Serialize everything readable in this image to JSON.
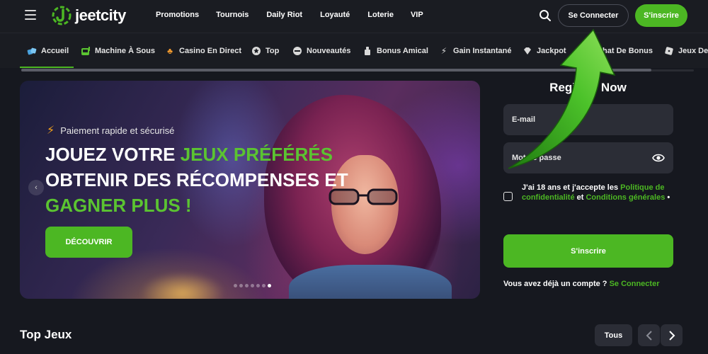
{
  "header": {
    "logo_text": "jeetcity",
    "nav": [
      "Promotions",
      "Tournois",
      "Daily Riot",
      "Loyauté",
      "Loterie",
      "VIP"
    ],
    "login_label": "Se Connecter",
    "signup_label": "S'inscrire"
  },
  "categories": [
    {
      "label": "Accueil",
      "icon": "home-icon",
      "active": true
    },
    {
      "label": "Machine À Sous",
      "icon": "slot-machine-icon"
    },
    {
      "label": "Casino En Direct",
      "icon": "club-icon"
    },
    {
      "label": "Top",
      "icon": "star-icon"
    },
    {
      "label": "Nouveautés",
      "icon": "new-badge-icon"
    },
    {
      "label": "Bonus Amical",
      "icon": "gift-icon"
    },
    {
      "label": "Gain Instantané",
      "icon": "lightning-icon"
    },
    {
      "label": "Jackpot",
      "icon": "diamond-icon"
    },
    {
      "label": "Achat De Bonus",
      "icon": "cart-icon"
    },
    {
      "label": "Jeux De",
      "icon": "dice-icon"
    }
  ],
  "hero": {
    "tagline": "Paiement rapide et sécurisé",
    "title_white_1": "JOUEZ VOTRE ",
    "title_green_1": "JEUX PRÉFÉRÉS",
    "title_white_2": "OBTENIR DES RÉCOMPENSES ET",
    "title_green_2": "GAGNER PLUS !",
    "cta_label": "DÉCOUVRIR",
    "slide_count": 7,
    "active_slide": 6
  },
  "register": {
    "title": "Register Now",
    "email_placeholder": "E-mail",
    "password_placeholder": "Mot de passe",
    "terms_prefix": "J'ai 18 ans et j'accepte les ",
    "privacy_link": "Politique de confidentialité",
    "terms_and": " et ",
    "terms_link": "Conditions générales",
    "terms_suffix": " •",
    "submit_label": "S'inscrire",
    "have_account": "Vous avez déjà un compte ? ",
    "login_link": "Se Connecter"
  },
  "top_games": {
    "title": "Top Jeux",
    "all_label": "Tous"
  },
  "colors": {
    "accent": "#4cb723",
    "background": "#16181f",
    "header": "#1a1c22",
    "field": "#2b2d36"
  }
}
